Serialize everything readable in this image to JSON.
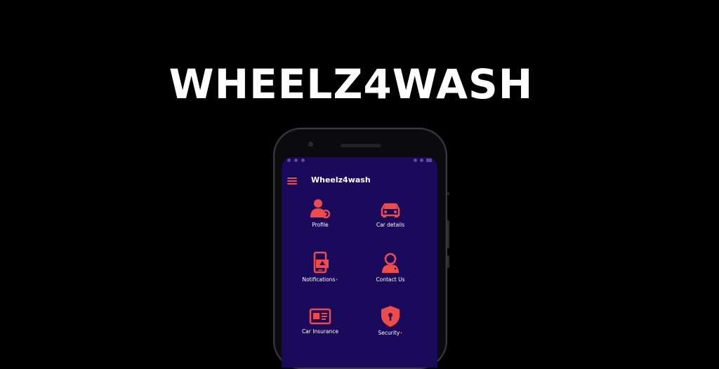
{
  "hero": {
    "title": "WHEELZ4WASH"
  },
  "app": {
    "title": "Wheelz4wash"
  },
  "colors": {
    "accent": "#f04b47",
    "screen_bg": "#1a0a5c",
    "page_bg": "#000000"
  },
  "menu": [
    {
      "label": "Profile",
      "icon": "profile-settings-icon"
    },
    {
      "label": "Car details",
      "icon": "car-icon"
    },
    {
      "label": "Notifications",
      "icon": "phone-notification-icon",
      "badge": "•"
    },
    {
      "label": "Contact Us",
      "icon": "support-agent-icon"
    },
    {
      "label": "Car Insurance",
      "icon": "id-card-icon"
    },
    {
      "label": "Security",
      "icon": "shield-lock-icon",
      "badge": "•"
    }
  ]
}
